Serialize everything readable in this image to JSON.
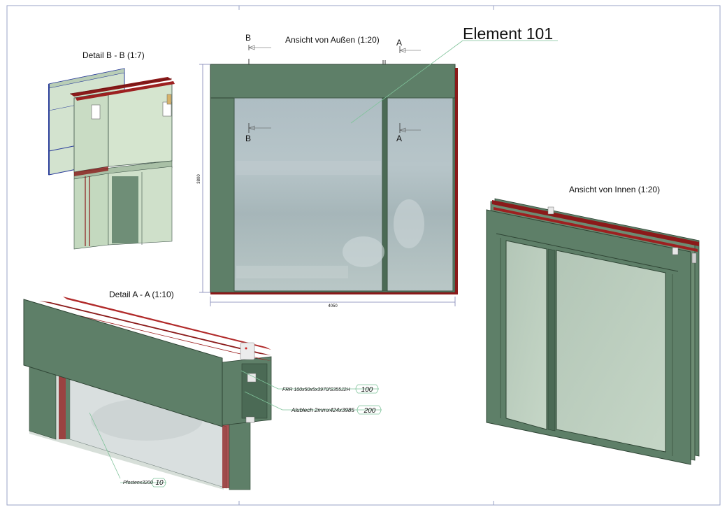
{
  "sheet": {
    "title": "Element 101",
    "views": {
      "exterior": "Ansicht von Außen  (1:20)",
      "interior": "Ansicht von Innen (1:20)",
      "detail_bb": "Detail B - B  (1:7)",
      "detail_aa": "Detail A - A  (1:10)"
    },
    "section_markers": [
      "B",
      "A",
      "B",
      "A"
    ],
    "dimensions": {
      "height": "3800",
      "width": "4050"
    },
    "part_tags": [
      {
        "text": "FRR 100x50x5x3970/S355J2H",
        "pos": "100"
      },
      {
        "text": "Alublech 2mmx424x3985",
        "pos": "200"
      },
      {
        "text": "Pfostenx3200",
        "pos": "10"
      }
    ],
    "colors": {
      "panel_green": "#5e7f68",
      "frame_dark": "#4b6a55",
      "glass": "#a9b9be",
      "steel_red": "#8b1a1a",
      "light_green": "#c9dcc4"
    }
  }
}
